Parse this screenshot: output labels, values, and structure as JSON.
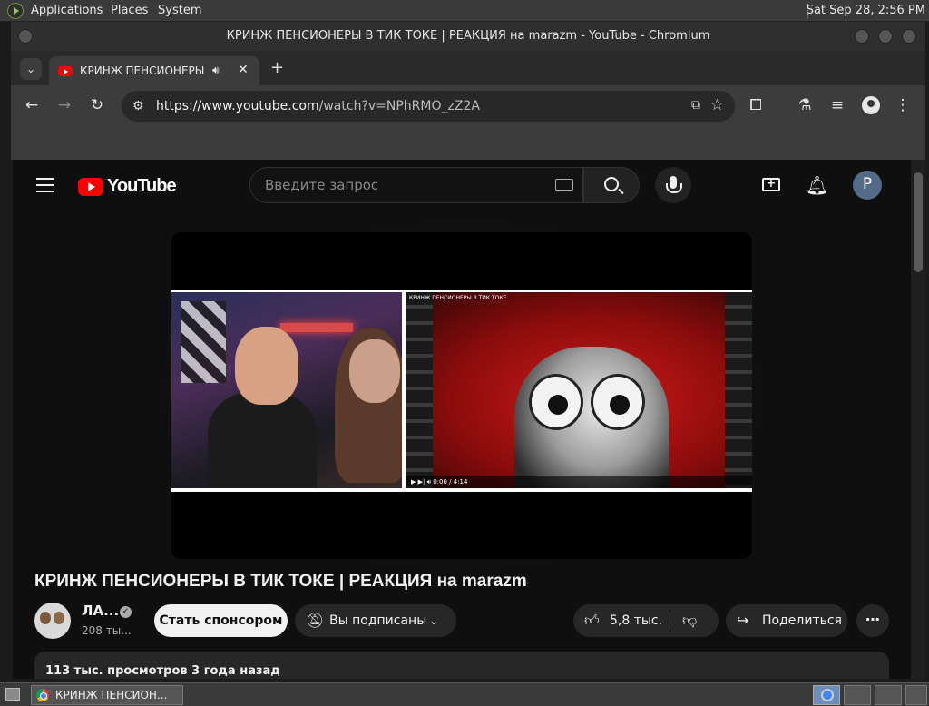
{
  "top_panel": {
    "menus": [
      "Applications",
      "Places",
      "System"
    ],
    "clock": "Sat Sep 28,  2:56 PM"
  },
  "window": {
    "title": "КРИНЖ ПЕНСИОНЕРЫ В ТИК ТОКЕ | РЕАКЦИЯ на marazm - YouTube - Chromium"
  },
  "browser": {
    "tab_title": "КРИНЖ ПЕНСИОНЕРЫ В ТИК ТОКЕ | РЕАКЦИЯ на marazm - YouTube",
    "url_host": "https://www.youtube.com",
    "url_path": "/watch?v=NPhRMO_zZ2A"
  },
  "youtube": {
    "logo_text": "YouTube",
    "search_placeholder": "Введите запрос",
    "avatar_letter": "P",
    "video_title": "КРИНЖ ПЕНСИОНЕРЫ В ТИК ТОКЕ | РЕАКЦИЯ на marazm",
    "clip_overlay_title": "КРИНЖ ПЕНСИОНЕРЫ В ТИК ТОКЕ",
    "clip_time": "0:00 / 4:14",
    "channel_name": "ЛА...",
    "subscribers": "208 ты...",
    "sponsor_label": "Стать спонсором",
    "subscribed_label": "Вы подписаны",
    "likes": "5,8 тыс.",
    "share_label": "Поделиться",
    "description_meta": "113 тыс. просмотров  3 года назад"
  },
  "taskbar": {
    "task_label": "КРИНЖ ПЕНСИОН..."
  }
}
